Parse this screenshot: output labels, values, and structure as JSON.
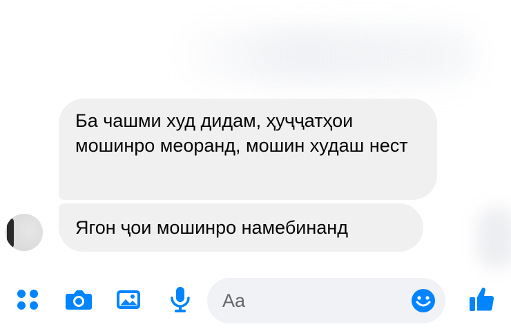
{
  "conversation": {
    "messages": [
      {
        "text": "Ба чашми худ дидам, ҳуҷҷатҳои мошинро меоранд, мошин худаш нест"
      },
      {
        "text": "Ягон ҷои мошинро намебинанд"
      }
    ]
  },
  "composer": {
    "placeholder": "Aa",
    "icons": [
      "apps-icon",
      "camera-icon",
      "image-icon",
      "microphone-icon",
      "emoji-icon",
      "thumbs-up-icon"
    ]
  },
  "colors": {
    "accent": "#0084ff",
    "bubble": "#f0f0f0",
    "composer": "#f0f2f5",
    "text": "#050505",
    "placeholder": "#65676b"
  }
}
